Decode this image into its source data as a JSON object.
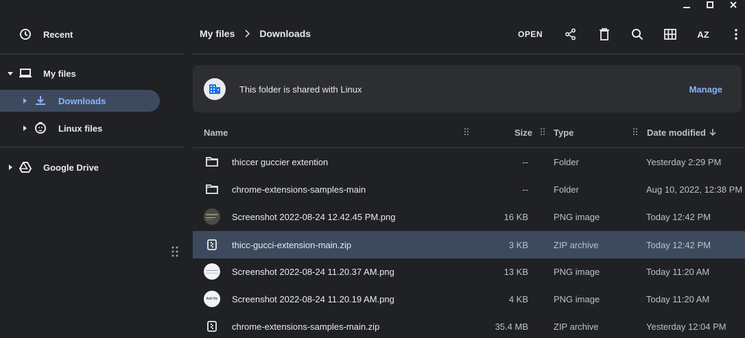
{
  "window": {
    "controls": [
      "minimize",
      "maximize",
      "close"
    ]
  },
  "sidebar": {
    "items": [
      {
        "label": "Recent",
        "icon": "clock-icon"
      },
      {
        "label": "My files",
        "icon": "laptop-icon"
      },
      {
        "label": "Downloads",
        "icon": "download-icon"
      },
      {
        "label": "Linux files",
        "icon": "penguin-icon"
      },
      {
        "label": "Google Drive",
        "icon": "drive-icon"
      }
    ]
  },
  "header": {
    "breadcrumb": [
      "My files",
      "Downloads"
    ],
    "open_label": "OPEN",
    "toolbar_icons": [
      "share-icon",
      "delete-icon",
      "search-icon",
      "grid-view-icon",
      "sort-icon",
      "more-icon"
    ],
    "sort_label": "AZ"
  },
  "banner": {
    "text": "This folder is shared with Linux",
    "link": "Manage"
  },
  "table": {
    "columns": {
      "name": "Name",
      "size": "Size",
      "type": "Type",
      "date": "Date modified"
    },
    "rows": [
      {
        "name": "thiccer guccier extention",
        "size": "--",
        "type": "Folder",
        "date": "Yesterday 2:29 PM",
        "icon": "folder-icon"
      },
      {
        "name": "chrome-extensions-samples-main",
        "size": "--",
        "type": "Folder",
        "date": "Aug 10, 2022, 12:38 PM",
        "icon": "folder-icon"
      },
      {
        "name": "Screenshot 2022-08-24 12.42.45 PM.png",
        "size": "16 KB",
        "type": "PNG image",
        "date": "Today 12:42 PM",
        "icon": "image-thumbnail-dark"
      },
      {
        "name": "thicc-gucci-extension-main.zip",
        "size": "3 KB",
        "type": "ZIP archive",
        "date": "Today 12:42 PM",
        "icon": "zip-icon",
        "selected": true
      },
      {
        "name": "Screenshot 2022-08-24 11.20.37 AM.png",
        "size": "13 KB",
        "type": "PNG image",
        "date": "Today 11:20 AM",
        "icon": "image-thumbnail-light"
      },
      {
        "name": "Screenshot 2022-08-24 11.20.19 AM.png",
        "size": "4 KB",
        "type": "PNG image",
        "date": "Today 11:20 AM",
        "icon": "image-thumbnail-addfile"
      },
      {
        "name": "chrome-extensions-samples-main.zip",
        "size": "35.4 MB",
        "type": "ZIP archive",
        "date": "Yesterday 12:04 PM",
        "icon": "zip-icon"
      }
    ],
    "thumb_text": "Add file"
  },
  "colors": {
    "background": "#202124",
    "selected": "#3d4a5e",
    "accent": "#8ab4f8",
    "banner": "#2d2e31",
    "divider": "#3c4043"
  }
}
